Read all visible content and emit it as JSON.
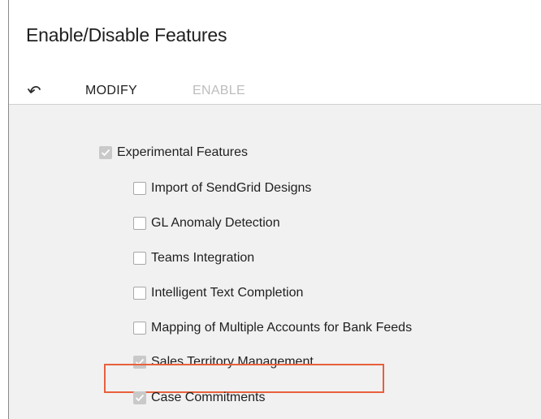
{
  "page": {
    "title": "Enable/Disable Features"
  },
  "toolbar": {
    "undo_icon": "undo-icon",
    "modify_label": "MODIFY",
    "enable_label": "ENABLE"
  },
  "features": {
    "parent": {
      "label": "Experimental Features",
      "checked": true
    },
    "items": [
      {
        "label": "Import of SendGrid Designs",
        "checked": false
      },
      {
        "label": "GL Anomaly Detection",
        "checked": false
      },
      {
        "label": "Teams Integration",
        "checked": false
      },
      {
        "label": "Intelligent Text Completion",
        "checked": false
      },
      {
        "label": "Mapping of Multiple Accounts for Bank Feeds",
        "checked": false
      },
      {
        "label": "Sales Territory Management",
        "checked": true
      },
      {
        "label": "Case Commitments",
        "checked": true
      }
    ]
  },
  "colors": {
    "highlight_border": "#e8603c",
    "content_background": "#f1f1f1",
    "disabled_text": "#bdbdbd"
  }
}
